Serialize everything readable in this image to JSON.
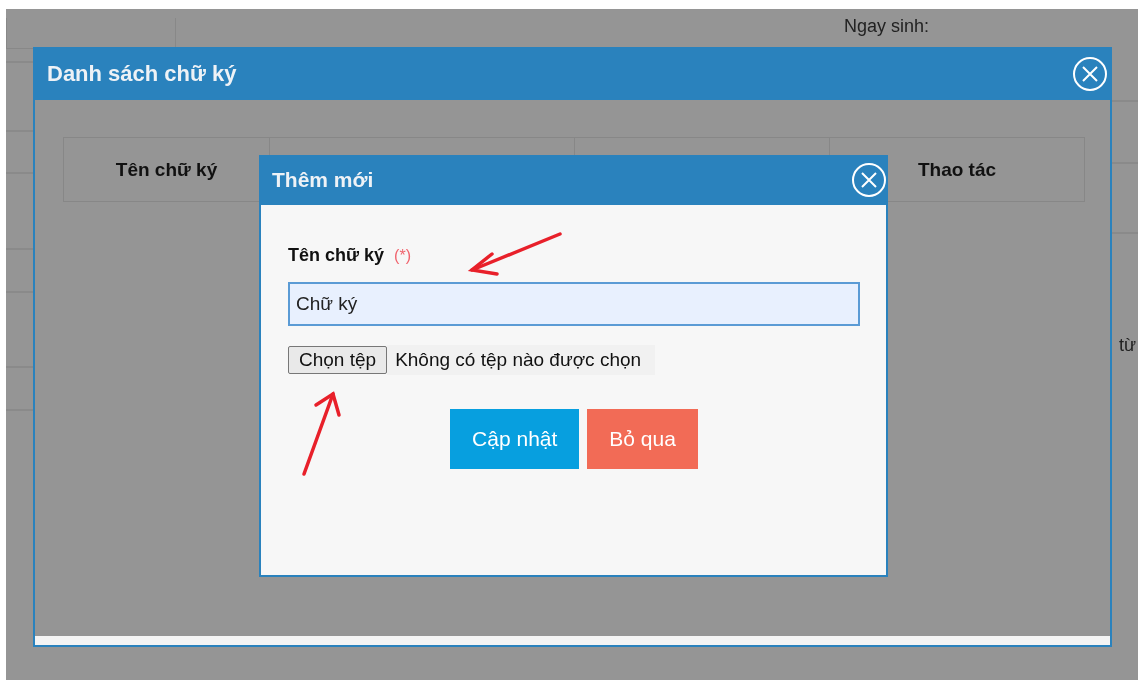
{
  "background": {
    "texts": [
      "Ngay sinh:",
      "từ"
    ]
  },
  "outer_dialog": {
    "title": "Danh sách chữ ký",
    "table": {
      "columns": [
        {
          "label": "Tên chữ ký"
        },
        {},
        {},
        {
          "label": "Thao tác"
        }
      ]
    }
  },
  "add_dialog": {
    "title": "Thêm mới",
    "field": {
      "label": "Tên chữ ký",
      "required_mark": "(*)",
      "value": "Chữ ký",
      "focused": true
    },
    "file_picker": {
      "button": "Chọn tệp",
      "status": "Không có tệp nào được chọn"
    },
    "buttons": [
      {
        "label": "Cập nhật",
        "kind": "primary"
      },
      {
        "label": "Bỏ qua",
        "kind": "cancel"
      }
    ]
  },
  "annotations": [
    {
      "kind": "arrow"
    },
    {
      "kind": "arrow"
    }
  ]
}
